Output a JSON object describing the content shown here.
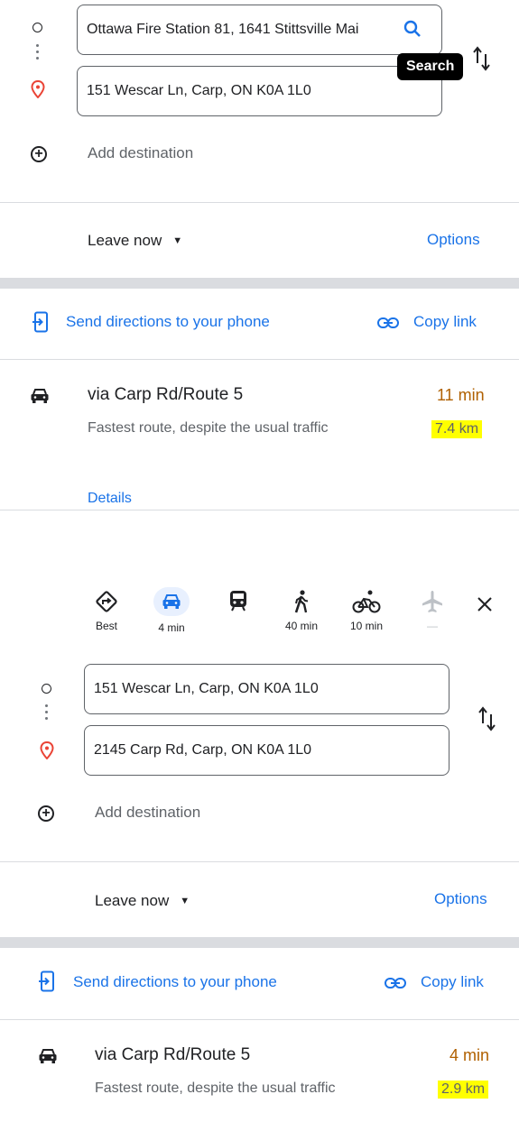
{
  "panel1": {
    "origin_value": "Ottawa Fire Station 81, 1641 Stittsville Mai",
    "destination_value": "151 Wescar Ln, Carp, ON K0A 1L0",
    "tooltip": "Search",
    "add_destination": "Add destination",
    "leave_now": "Leave now",
    "options": "Options",
    "send_directions": "Send directions to your phone",
    "copy_link": "Copy link",
    "route": {
      "via": "via Carp Rd/Route 5",
      "time": "11 min",
      "note": "Fastest route, despite the usual traffic",
      "distance": "7.4 km",
      "details": "Details"
    }
  },
  "panel2": {
    "modes": [
      {
        "icon": "best-route-icon",
        "label": "Best"
      },
      {
        "icon": "car-icon",
        "label": "4 min"
      },
      {
        "icon": "transit-icon",
        "label": ""
      },
      {
        "icon": "walk-icon",
        "label": "40 min"
      },
      {
        "icon": "bike-icon",
        "label": "10 min"
      },
      {
        "icon": "flight-icon",
        "label": "—"
      }
    ],
    "origin_value": "151 Wescar Ln, Carp, ON K0A 1L0",
    "destination_value": "2145 Carp Rd, Carp, ON K0A 1L0",
    "add_destination": "Add destination",
    "leave_now": "Leave now",
    "options": "Options",
    "send_directions": "Send directions to your phone",
    "copy_link": "Copy link",
    "route": {
      "via": "via Carp Rd/Route 5",
      "time": "4 min",
      "note": "Fastest route, despite the usual traffic",
      "distance": "2.9 km"
    }
  },
  "colors": {
    "accent": "#1a73e8",
    "time": "#b06000",
    "highlight": "#ffff00",
    "destination_pin": "#ea4335"
  }
}
